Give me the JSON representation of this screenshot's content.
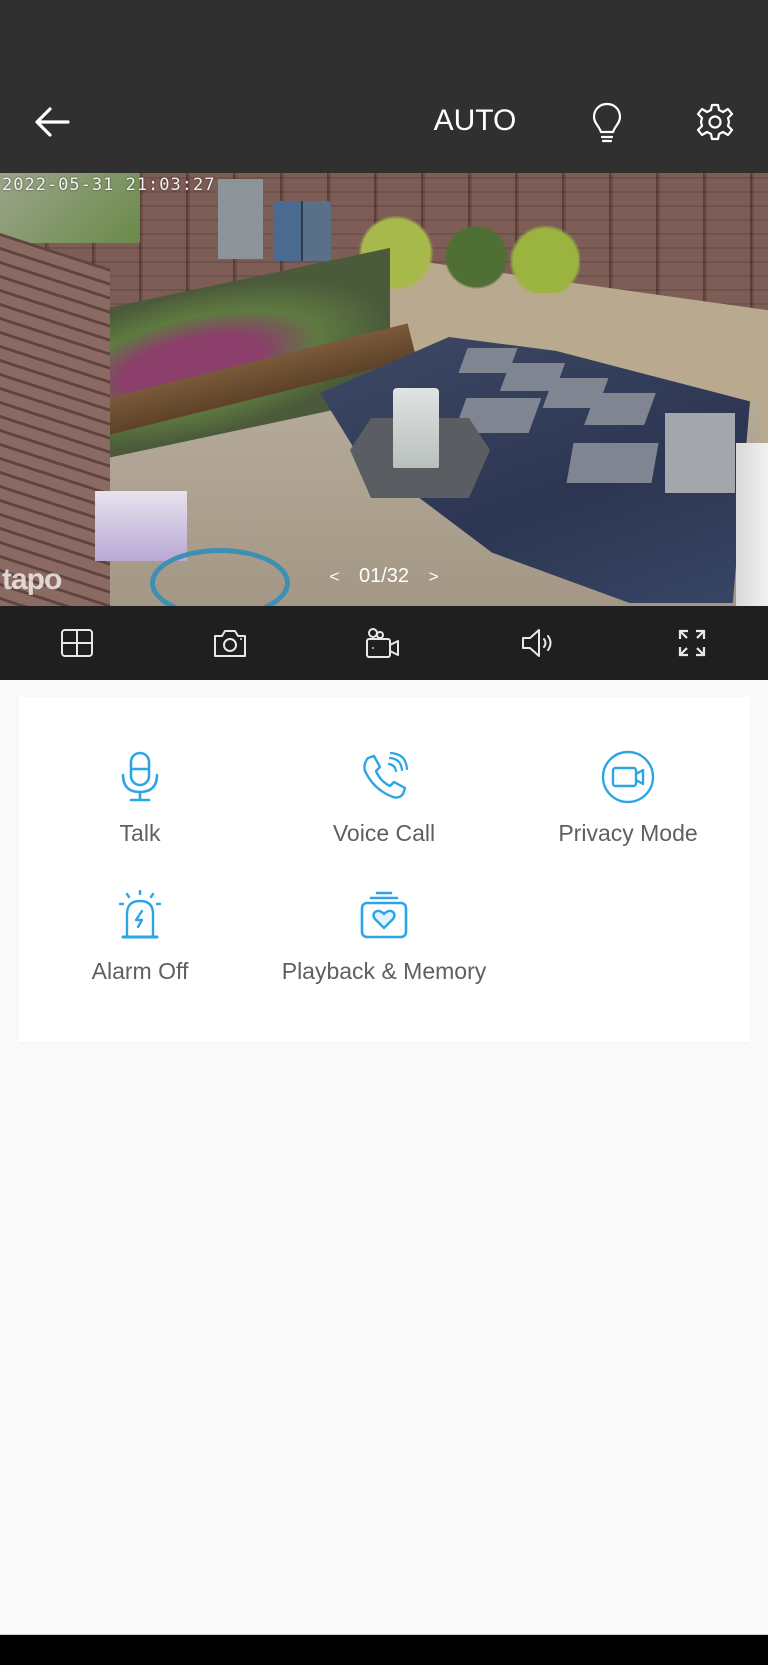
{
  "header": {
    "back_icon": "arrow-left-icon",
    "night_vision_mode": "AUTO",
    "light_icon": "lightbulb-icon",
    "settings_icon": "gear-icon"
  },
  "video": {
    "timestamp": "2022-05-31 21:03:27",
    "watermark": "tapo",
    "pager": {
      "prev": "<",
      "current": "01/32",
      "next": ">"
    }
  },
  "toolbar": {
    "items": [
      {
        "name": "multi-view",
        "icon": "grid-icon"
      },
      {
        "name": "snapshot",
        "icon": "camera-icon"
      },
      {
        "name": "record",
        "icon": "video-record-icon"
      },
      {
        "name": "sound",
        "icon": "speaker-icon"
      },
      {
        "name": "fullscreen",
        "icon": "expand-icon"
      }
    ]
  },
  "actions": {
    "accent_color": "#2aa6e8",
    "items": [
      {
        "label": "Talk",
        "icon": "microphone-icon"
      },
      {
        "label": "Voice Call",
        "icon": "phone-call-icon"
      },
      {
        "label": "Privacy Mode",
        "icon": "privacy-camera-icon"
      },
      {
        "label": "Alarm Off",
        "icon": "alarm-siren-icon"
      },
      {
        "label": "Playback & Memory",
        "icon": "memory-album-icon"
      }
    ]
  }
}
